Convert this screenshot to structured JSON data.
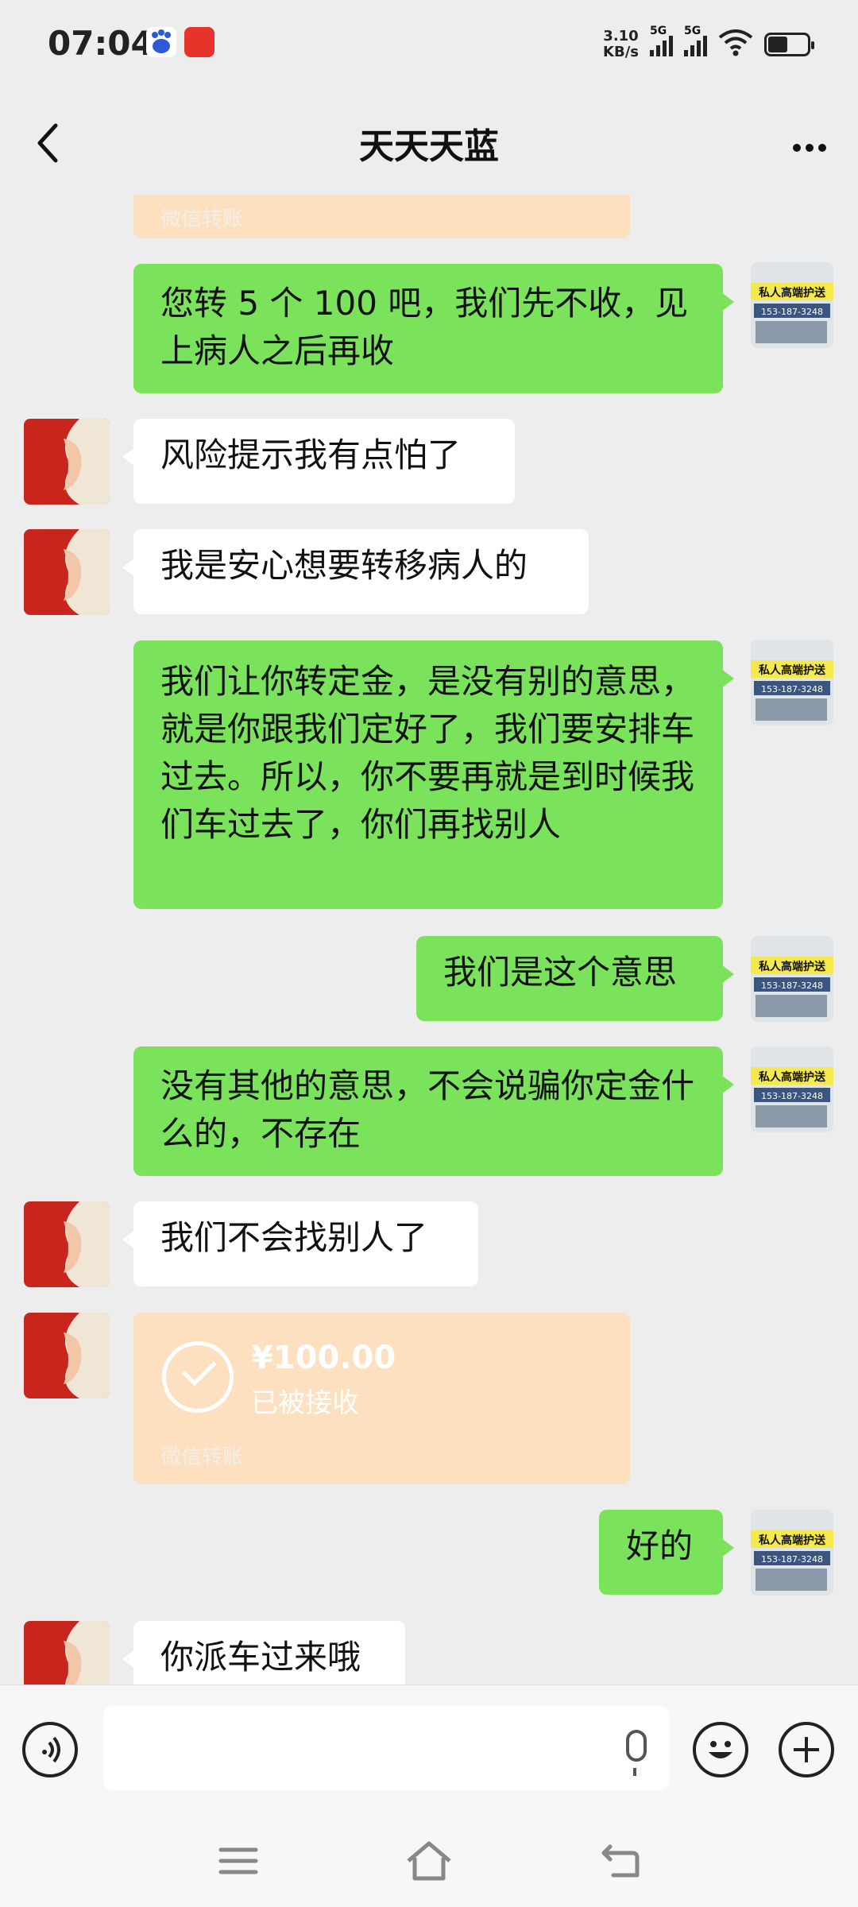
{
  "status_bar": {
    "time": "07:04",
    "net_speed_value": "3.10",
    "net_speed_unit": "KB/s",
    "signal1_label": "5G",
    "signal2_label": "5G",
    "icons": [
      "baidu-app-icon",
      "shopping-app-icon",
      "signal-icon",
      "signal-icon",
      "wifi-icon",
      "battery-icon"
    ]
  },
  "header": {
    "title": "天天天蓝",
    "back_icon": "chevron-left-icon",
    "more_icon": "more-dots-icon"
  },
  "messages": [
    {
      "from": "me",
      "type": "transfer-partial",
      "label": "微信转账"
    },
    {
      "from": "me",
      "type": "text",
      "text": "您转 5 个 100 吧，我们先不收，见上病人之后再收"
    },
    {
      "from": "other",
      "type": "text",
      "text": "风险提示我有点怕了"
    },
    {
      "from": "other",
      "type": "text",
      "text": "我是安心想要转移病人的"
    },
    {
      "from": "me",
      "type": "text",
      "text": "我们让你转定金，是没有别的意思，就是你跟我们定好了，我们要安排车过去。所以，你不要再就是到时候我们车过去了，你们再找别人"
    },
    {
      "from": "me",
      "type": "text",
      "text": "我们是这个意思"
    },
    {
      "from": "me",
      "type": "text",
      "text": "没有其他的意思，不会说骗你定金什么的，不存在"
    },
    {
      "from": "other",
      "type": "text",
      "text": "我们不会找别人了"
    },
    {
      "from": "other",
      "type": "transfer",
      "amount": "¥100.00",
      "status": "已被接收",
      "label": "微信转账"
    },
    {
      "from": "me",
      "type": "text",
      "text": "好的"
    },
    {
      "from": "other",
      "type": "text",
      "text": "你派车过来哦"
    }
  ],
  "my_avatar_text": {
    "line1": "私人高端护送",
    "line2": "153-187-3248"
  },
  "input_bar": {
    "voice_icon": "voice-icon",
    "mic_icon": "mic-icon",
    "emoji_icon": "emoji-icon",
    "plus_icon": "plus-icon"
  },
  "nav_bar": {
    "icons": [
      "menu-icon",
      "home-icon",
      "back-nav-icon"
    ]
  }
}
